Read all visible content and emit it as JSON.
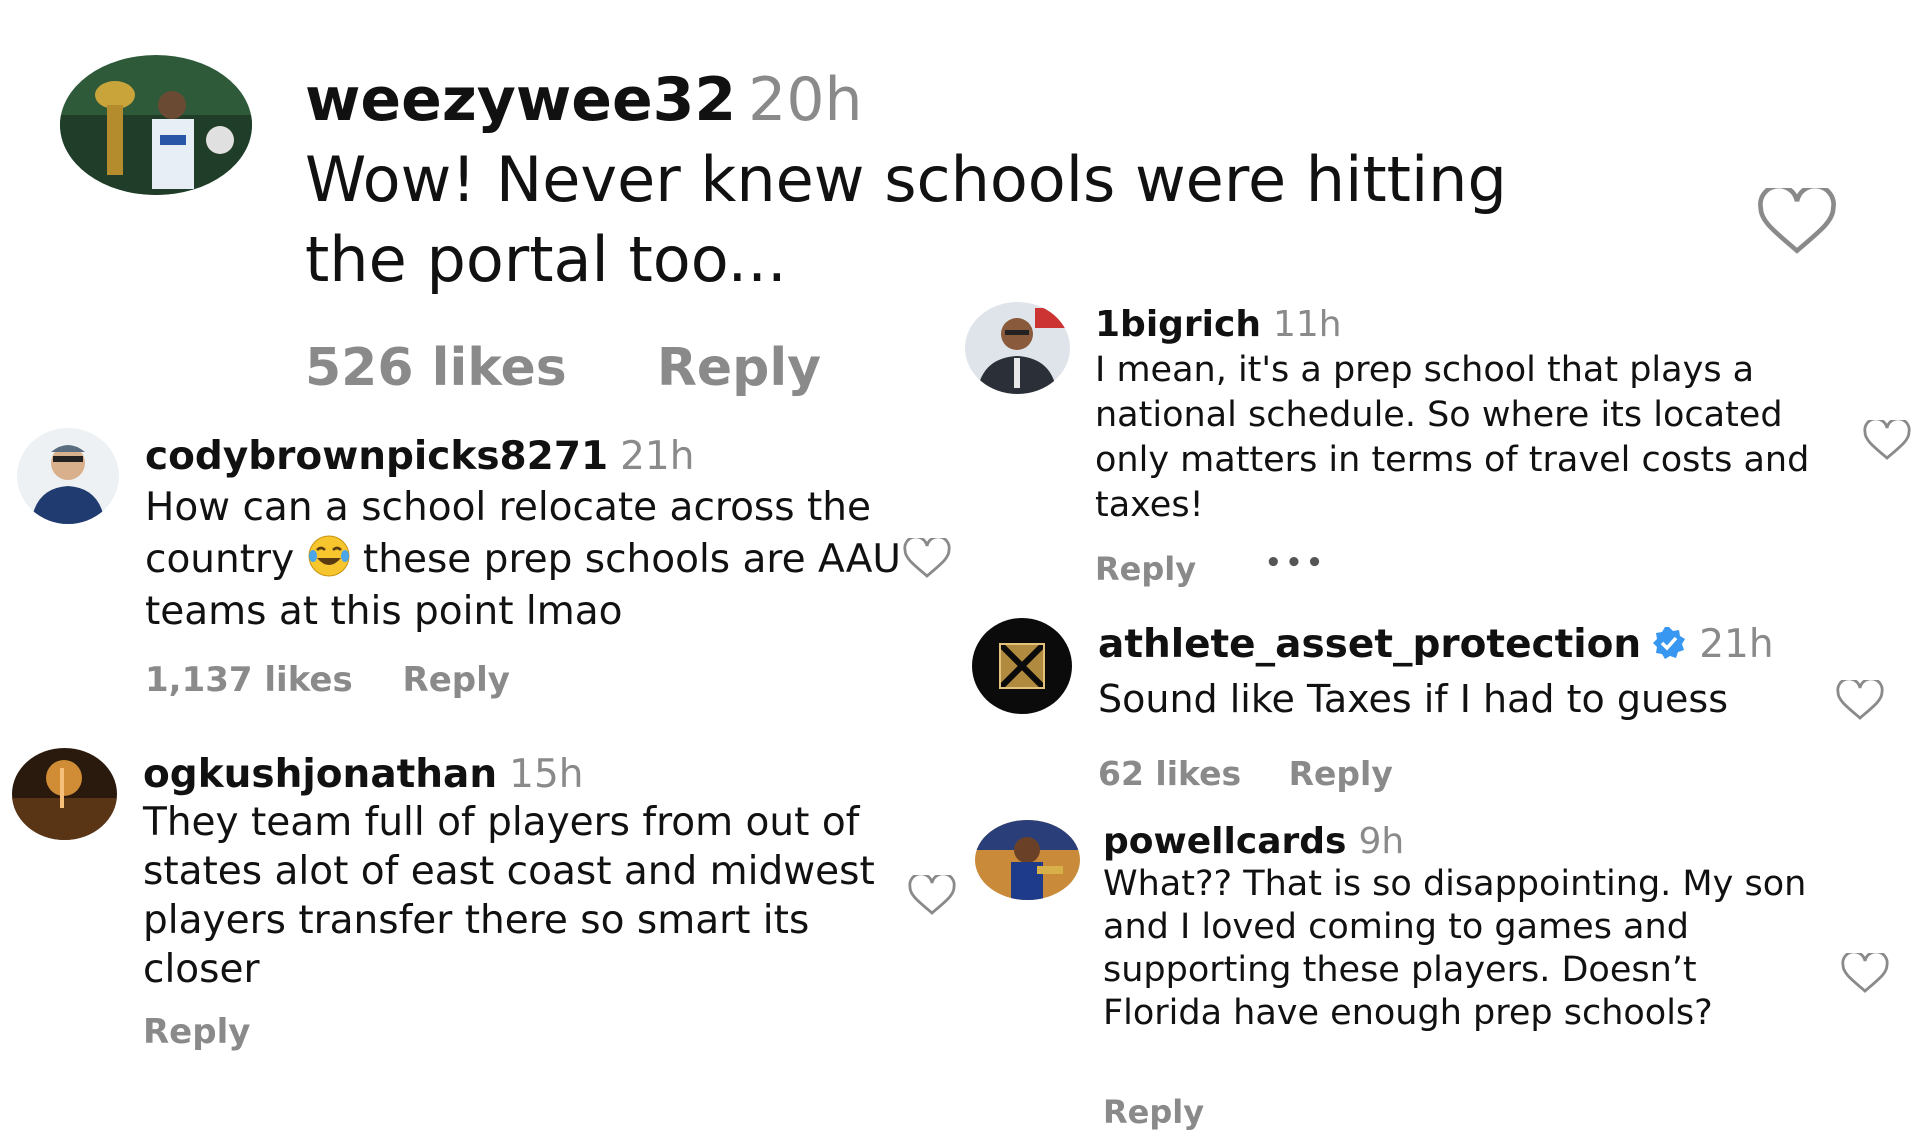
{
  "colors": {
    "text": "#111111",
    "muted": "#8a8a8a",
    "verified": "#3897f0"
  },
  "comments": [
    {
      "username": "weezywee32",
      "time": "20h",
      "text": "Wow! Never knew schools were hitting the portal too...",
      "likes": "526 likes",
      "reply": "Reply"
    },
    {
      "username": "codybrownpicks8271",
      "time": "21h",
      "text_a": "How can a school relocate across the country",
      "emoji": "face-with-tears-of-joy-icon",
      "text_b": "these prep schools are AAU teams at this point lmao",
      "likes": "1,137 likes",
      "reply": "Reply"
    },
    {
      "username": "ogkushjonathan",
      "time": "15h",
      "text": "They team full of players from out of states alot of east coast and midwest players transfer there so smart its closer",
      "reply": "Reply"
    },
    {
      "username": "1bigrich",
      "time": "11h",
      "text": "I mean, it's a prep school that plays a national schedule. So where its located only matters in terms of travel costs and taxes!",
      "reply": "Reply",
      "more": "•••"
    },
    {
      "username": "athlete_asset_protection",
      "time": "21h",
      "verified": true,
      "text": "Sound like Taxes if I had to guess",
      "likes": "62 likes",
      "reply": "Reply"
    },
    {
      "username": "powellcards",
      "time": "9h",
      "text": "What?? That is so disappointing. My son and I loved coming to games and supporting these players. Doesn’t Florida have enough prep schools?",
      "reply": "Reply"
    }
  ]
}
